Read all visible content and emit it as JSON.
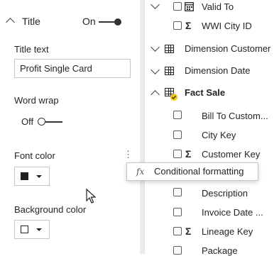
{
  "format_pane": {
    "title_section": {
      "label": "Title",
      "toggle_state": "On"
    },
    "title_text": {
      "label": "Title text",
      "value": "Profit Single Card"
    },
    "word_wrap": {
      "label": "Word wrap",
      "toggle_state": "Off"
    },
    "font_color": {
      "label": "Font color",
      "color": "#1f1f1f",
      "more_glyph": "⋮"
    },
    "background_color": {
      "label": "Background color",
      "color": "#ffffff"
    }
  },
  "context_menu": {
    "icon_text": "fx",
    "label": "Conditional formatting"
  },
  "fields": {
    "items": [
      {
        "label": "Valid To",
        "kind": "calendar"
      },
      {
        "label": "WWI City ID",
        "kind": "sigma"
      },
      {
        "label": "Dimension Customer",
        "kind": "table"
      },
      {
        "label": "Dimension Date",
        "kind": "table"
      },
      {
        "label": "Fact Sale",
        "kind": "table-expanded"
      },
      {
        "label": "Bill To Custom...",
        "kind": "plain"
      },
      {
        "label": "City Key",
        "kind": "plain"
      },
      {
        "label": "Customer Key",
        "kind": "sigma"
      },
      {
        "label": "Description",
        "kind": "plain"
      },
      {
        "label": "Invoice Date ...",
        "kind": "plain"
      },
      {
        "label": "Lineage Key",
        "kind": "sigma"
      },
      {
        "label": "Package",
        "kind": "plain"
      }
    ]
  }
}
